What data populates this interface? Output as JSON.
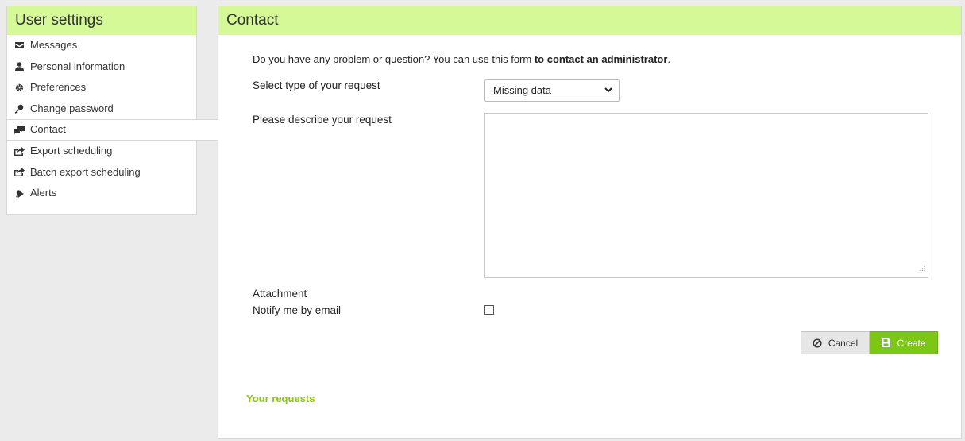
{
  "sidebar": {
    "title": "User settings",
    "items": [
      {
        "label": "Messages",
        "icon": "envelope-icon"
      },
      {
        "label": "Personal information",
        "icon": "user-icon"
      },
      {
        "label": "Preferences",
        "icon": "gear-icon"
      },
      {
        "label": "Change password",
        "icon": "key-icon"
      },
      {
        "label": "Contact",
        "icon": "chat-icon",
        "active": true
      },
      {
        "label": "Export scheduling",
        "icon": "share-icon"
      },
      {
        "label": "Batch export scheduling",
        "icon": "share-icon"
      },
      {
        "label": "Alerts",
        "icon": "bell-icon"
      }
    ]
  },
  "main": {
    "title": "Contact",
    "intro_prefix": "Do you have any problem or question? You can use this form ",
    "intro_bold": "to contact an administrator",
    "intro_suffix": ".",
    "request_type_label": "Select type of your request",
    "request_type_value": "Missing data",
    "describe_label": "Please describe your request",
    "describe_value": "",
    "attachment_label": "Attachment",
    "notify_label": "Notify me by email",
    "notify_checked": false,
    "cancel_label": "Cancel",
    "create_label": "Create",
    "requests_heading": "Your requests"
  },
  "colors": {
    "header_bg": "#d4f996",
    "accent_green": "#7cc615",
    "requests_text": "#8cc414"
  }
}
